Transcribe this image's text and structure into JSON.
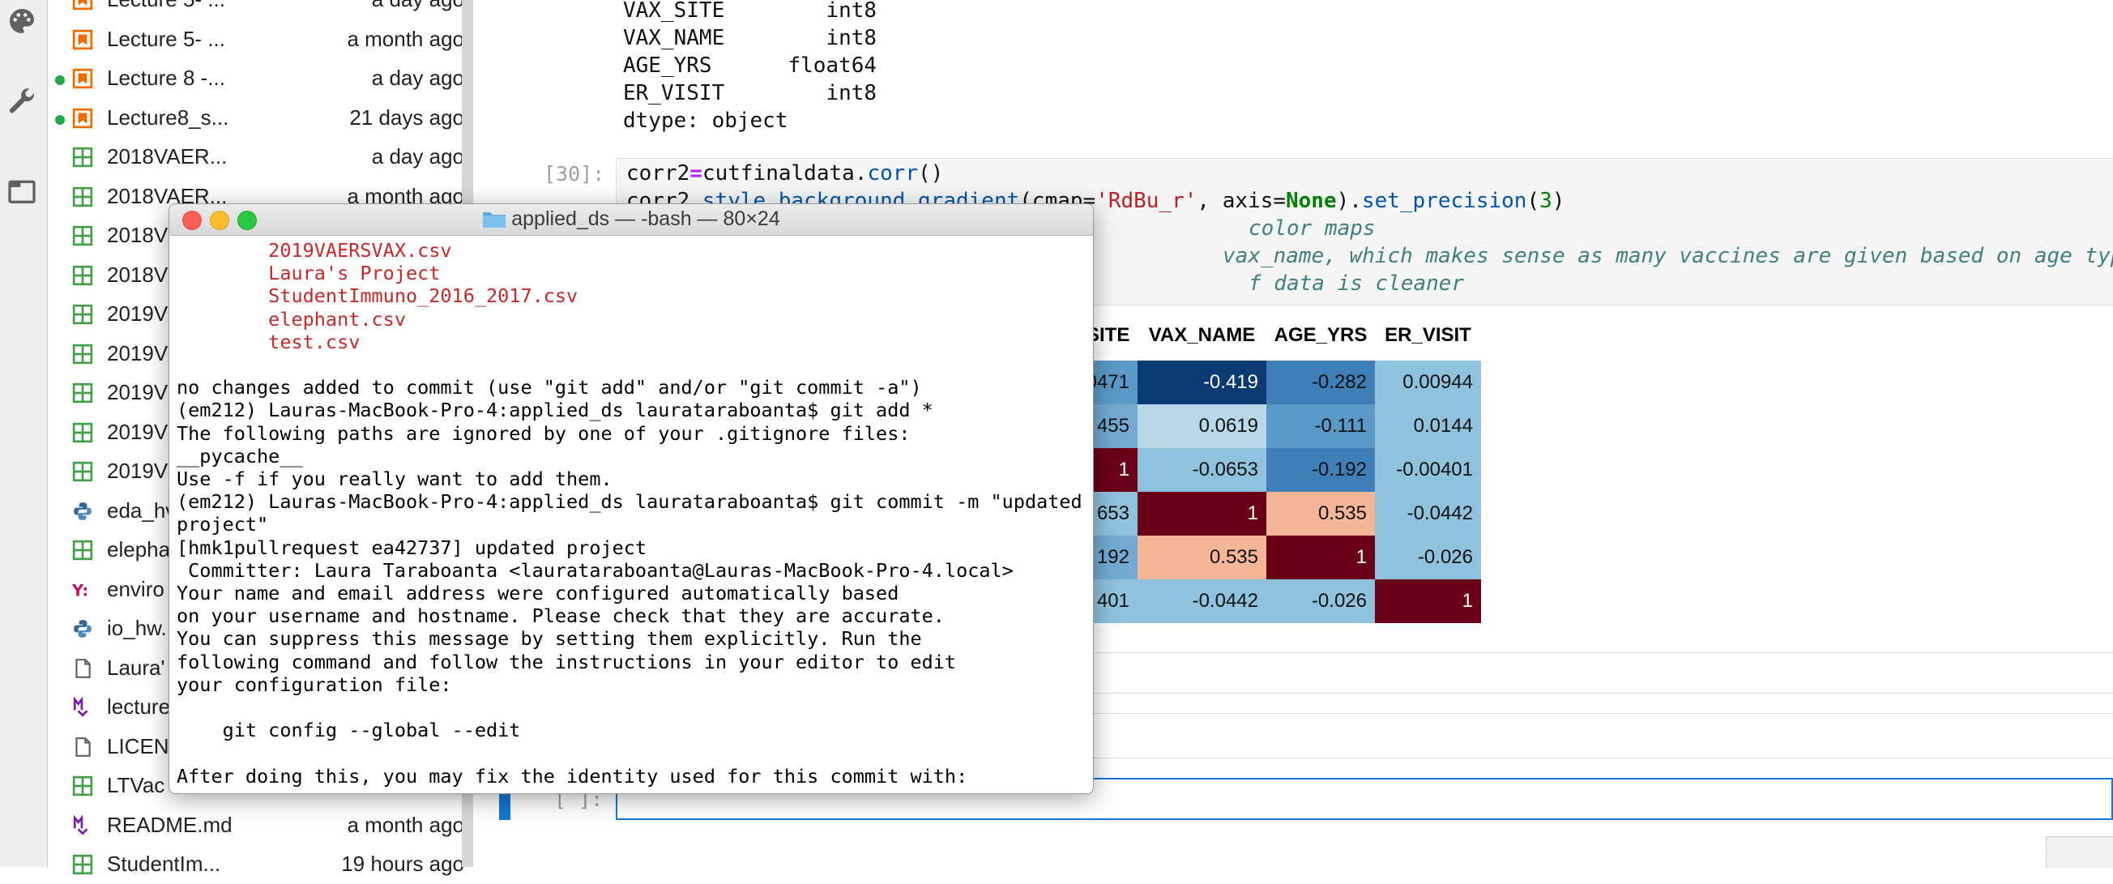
{
  "file_browser": {
    "items": [
      {
        "name": "Lecture 5- ...",
        "modified": "a day ago",
        "icon": "notebook-icon",
        "running": false
      },
      {
        "name": "Lecture 5- ...",
        "modified": "a month ago",
        "icon": "notebook-icon",
        "running": false
      },
      {
        "name": "Lecture 8 -...",
        "modified": "a day ago",
        "icon": "notebook-icon",
        "running": true
      },
      {
        "name": "Lecture8_s...",
        "modified": "21 days ago",
        "icon": "notebook-icon",
        "running": true
      },
      {
        "name": "2018VAER...",
        "modified": "a day ago",
        "icon": "csv-table-icon",
        "running": false
      },
      {
        "name": "2018VAER...",
        "modified": "a month ago",
        "icon": "csv-table-icon",
        "running": false
      },
      {
        "name": "2018V",
        "modified": "",
        "icon": "csv-table-icon",
        "running": false
      },
      {
        "name": "2018V",
        "modified": "",
        "icon": "csv-table-icon",
        "running": false
      },
      {
        "name": "2019V",
        "modified": "",
        "icon": "csv-table-icon",
        "running": false
      },
      {
        "name": "2019V",
        "modified": "",
        "icon": "csv-table-icon",
        "running": false
      },
      {
        "name": "2019V",
        "modified": "",
        "icon": "csv-table-icon",
        "running": false
      },
      {
        "name": "2019V",
        "modified": "",
        "icon": "csv-table-icon",
        "running": false
      },
      {
        "name": "2019V",
        "modified": "",
        "icon": "csv-table-icon",
        "running": false
      },
      {
        "name": "eda_hv",
        "modified": "",
        "icon": "python-icon",
        "running": false
      },
      {
        "name": "elepha",
        "modified": "",
        "icon": "csv-table-icon",
        "running": false
      },
      {
        "name": "enviro",
        "modified": "",
        "icon": "yaml-icon",
        "running": false
      },
      {
        "name": "io_hw.",
        "modified": "",
        "icon": "python-icon",
        "running": false
      },
      {
        "name": "Laura'",
        "modified": "",
        "icon": "file-icon",
        "running": false
      },
      {
        "name": "lecture",
        "modified": "",
        "icon": "markdown-icon",
        "running": false
      },
      {
        "name": "LICEN",
        "modified": "",
        "icon": "file-icon",
        "running": false
      },
      {
        "name": "LTVac",
        "modified": "",
        "icon": "csv-table-icon",
        "running": false
      },
      {
        "name": "README.md",
        "modified": "a month ago",
        "icon": "markdown-icon",
        "running": false
      },
      {
        "name": "StudentIm...",
        "modified": "19 hours ago",
        "icon": "csv-table-icon",
        "running": false
      }
    ]
  },
  "notebook": {
    "dtype_output": [
      "VAX_SITE        int8",
      "VAX_NAME        int8",
      "AGE_YRS      float64",
      "ER_VISIT        int8",
      "dtype: object"
    ],
    "cell30_prompt": "[30]:",
    "code_line1": {
      "a": "corr2",
      "eq": "=",
      "b": "cutfinaldata.",
      "fn": "corr",
      "c": "()"
    },
    "code_line2": {
      "a": "corr2.",
      "b": "style.background_gradient",
      "c": "(cmap=",
      "str": "'RdBu_r'",
      "d": ", axis=",
      "none": "None",
      "e": ").",
      "fn": "set_precision",
      "f": "(",
      "num": "3",
      "g": ")"
    },
    "comment1": "color maps",
    "comment2": "vax_name, which makes sense as many vaccines are given based on age type",
    "comment3": "f data is cleaner",
    "table_headers": [
      "SITE",
      "VAX_NAME",
      "AGE_YRS",
      "ER_VISIT"
    ],
    "table_rows": [
      [
        "0471",
        "-0.419",
        "-0.282",
        "0.00944"
      ],
      [
        "455",
        "0.0619",
        "-0.111",
        "0.0144"
      ],
      [
        "1",
        "-0.0653",
        "-0.192",
        "-0.00401"
      ],
      [
        "653",
        "1",
        "0.535",
        "-0.0442"
      ],
      [
        "192",
        "0.535",
        "1",
        "-0.026"
      ],
      [
        "401",
        "-0.0442",
        "-0.026",
        "1"
      ]
    ],
    "table_colors": [
      [
        "#5a99c8",
        "#0c3a73",
        "#3e7fb9",
        "#8fc2dd"
      ],
      [
        "#72aad2",
        "#b9d8e9",
        "#5a99c8",
        "#8fc2dd"
      ],
      [
        "#6a0018",
        "#8fc2dd",
        "#3e7fb9",
        "#8fc2dd"
      ],
      [
        "#8fc2dd",
        "#6a0018",
        "#f5b697",
        "#8fc2dd"
      ],
      [
        "#72aad2",
        "#f5b697",
        "#6a0018",
        "#8fc2dd"
      ],
      [
        "#8fc2dd",
        "#8fc2dd",
        "#8fc2dd",
        "#6a0018"
      ]
    ],
    "empty_prompt": "[ ]:"
  },
  "terminal": {
    "title": "applied_ds — -bash — 80×24",
    "red_lines": [
      "        2019VAERSVAX.csv",
      "        Laura's Project",
      "        StudentImmuno_2016_2017.csv",
      "        elephant.csv",
      "        test.csv"
    ],
    "lines": [
      "no changes added to commit (use \"git add\" and/or \"git commit -a\")",
      "(em212) Lauras-MacBook-Pro-4:applied_ds laurataraboanta$ git add *",
      "The following paths are ignored by one of your .gitignore files:",
      "__pycache__",
      "Use -f if you really want to add them.",
      "(em212) Lauras-MacBook-Pro-4:applied_ds laurataraboanta$ git commit -m \"updated",
      "project\"",
      "[hmk1pullrequest ea42737] updated project",
      " Committer: Laura Taraboanta <laurataraboanta@Lauras-MacBook-Pro-4.local>",
      "Your name and email address were configured automatically based",
      "on your username and hostname. Please check that they are accurate.",
      "You can suppress this message by setting them explicitly. Run the",
      "following command and follow the instructions in your editor to edit",
      "your configuration file:",
      "",
      "    git config --global --edit",
      "",
      "After doing this, you may fix the identity used for this commit with:"
    ]
  }
}
